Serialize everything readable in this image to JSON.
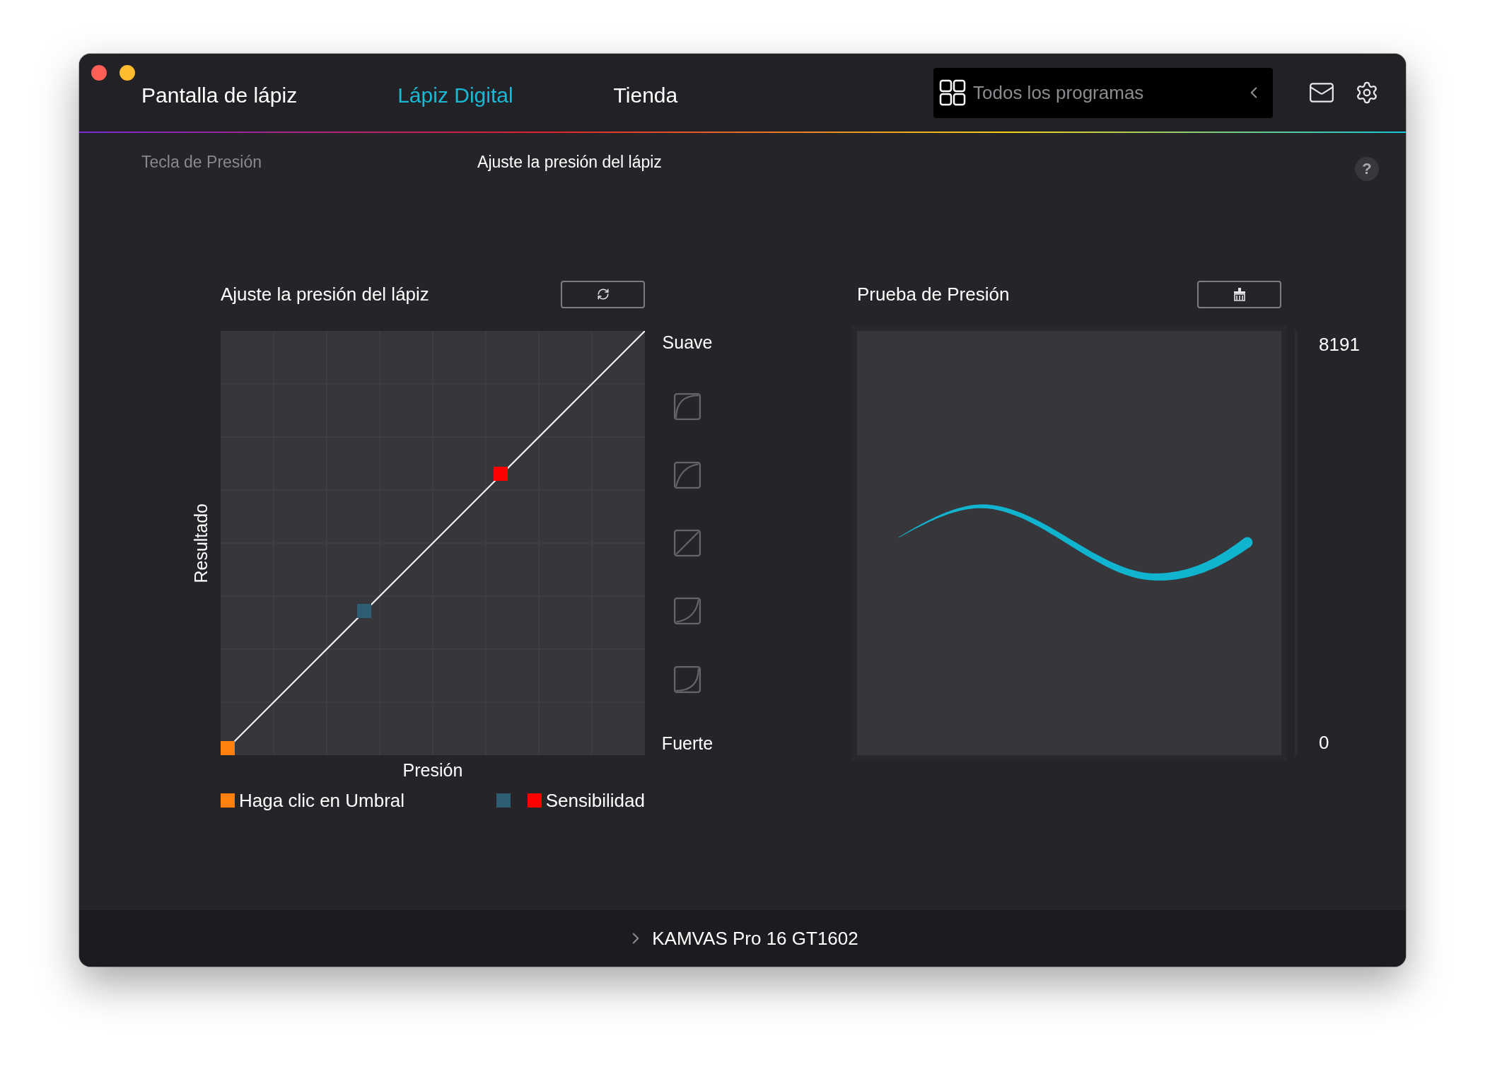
{
  "tabs": [
    {
      "label": "Pantalla de lápiz",
      "selected": false
    },
    {
      "label": "Lápiz Digital",
      "selected": true
    },
    {
      "label": "Tienda",
      "selected": false
    }
  ],
  "program_selector": {
    "value": "Todos los programas"
  },
  "subtabs": [
    {
      "label": "Tecla de Presión",
      "selected": false
    },
    {
      "label": "Ajuste la presión del lápiz",
      "selected": true
    }
  ],
  "help": "?",
  "curve_panel": {
    "title": "Ajuste la presión del lápiz",
    "y_label": "Resultado",
    "x_label": "Presión",
    "top_label": "Suave",
    "bottom_label": "Fuerte",
    "handles": [
      {
        "color": "#ff7f0f"
      },
      {
        "color": "#2d5e73"
      },
      {
        "color": "#ff0000"
      }
    ],
    "legend": [
      {
        "label": "Haga clic en Umbral",
        "swatches": [
          {
            "color": "#ff7f0f"
          }
        ]
      },
      {
        "label": "Sensibilidad",
        "swatches": [
          {
            "color": "#2d5e73"
          },
          {
            "color": "#ff0000"
          }
        ]
      }
    ]
  },
  "test_panel": {
    "title": "Prueba de Presión",
    "max_label": "8191",
    "min_label": "0"
  },
  "device": {
    "name": "KAMVAS Pro 16 GT1602"
  }
}
